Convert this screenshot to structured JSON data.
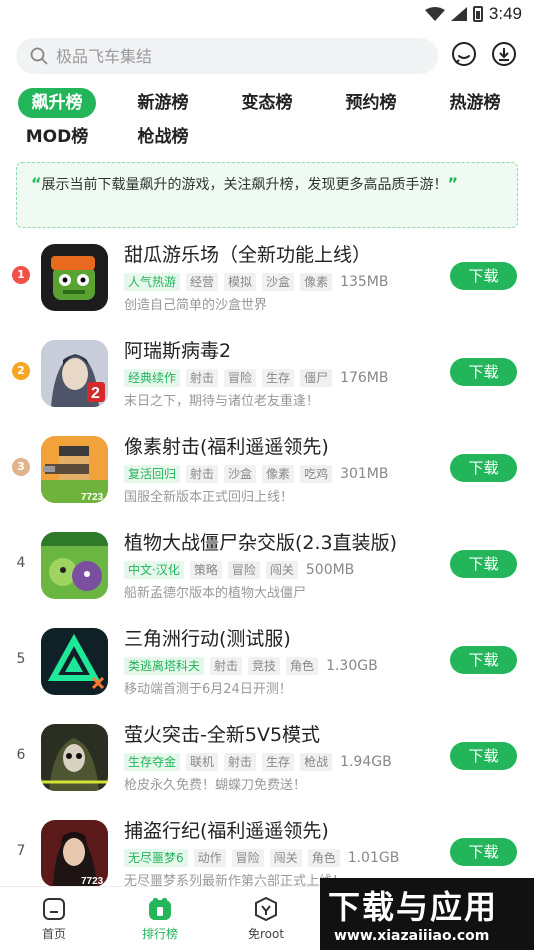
{
  "status": {
    "time": "3:49"
  },
  "search": {
    "placeholder": "极品飞车集结"
  },
  "icons": {
    "search": "search-icon",
    "message": "message-icon",
    "download": "download-icon"
  },
  "tabs": [
    {
      "label": "飙升榜",
      "active": true
    },
    {
      "label": "新游榜"
    },
    {
      "label": "变态榜"
    },
    {
      "label": "预约榜"
    },
    {
      "label": "热游榜"
    },
    {
      "label": "MOD榜"
    },
    {
      "label": "枪战榜"
    }
  ],
  "banner": {
    "open_quote": "“",
    "text": "展示当前下载量飙升的游戏，关注飙升榜，发现更多高品质手游！",
    "close_quote": "”"
  },
  "apps": [
    {
      "rank": "1",
      "title": "甜瓜游乐场（全新功能上线）",
      "tags": [
        "人气热游",
        "经营",
        "模拟",
        "沙盒",
        "像素"
      ],
      "size": "135MB",
      "desc": "创造自己简单的沙盒世界",
      "button": "下载"
    },
    {
      "rank": "2",
      "title": "阿瑞斯病毒2",
      "tags": [
        "经典续作",
        "射击",
        "冒险",
        "生存",
        "僵尸"
      ],
      "size": "176MB",
      "desc": "末日之下，期待与诸位老友重逢！",
      "button": "下载"
    },
    {
      "rank": "3",
      "title": "像素射击(福利遥遥领先)",
      "tags": [
        "复活回归",
        "射击",
        "沙盒",
        "像素",
        "吃鸡"
      ],
      "size": "301MB",
      "desc": "国服全新版本正式回归上线！",
      "button": "下载"
    },
    {
      "rank": "4",
      "title": "植物大战僵尸杂交版(2.3直装版)",
      "tags": [
        "中文·汉化",
        "策略",
        "冒险",
        "闯关"
      ],
      "size": "500MB",
      "desc": "船新孟德尔版本的植物大战僵尸",
      "button": "下载"
    },
    {
      "rank": "5",
      "title": "三角洲行动(测试服)",
      "tags": [
        "类逃离塔科夫",
        "射击",
        "竞技",
        "角色"
      ],
      "size": "1.30GB",
      "desc": "移动端首测于6月24日开测！",
      "button": "下载"
    },
    {
      "rank": "6",
      "title": "萤火突击-全新5V5模式",
      "tags": [
        "生存夺金",
        "联机",
        "射击",
        "生存",
        "枪战"
      ],
      "size": "1.94GB",
      "desc": "枪皮永久免费！蝴蝶刀免费送！",
      "button": "下载"
    },
    {
      "rank": "7",
      "title": "捕盗行纪(福利遥遥领先)",
      "tags": [
        "无尽噩梦6",
        "动作",
        "冒险",
        "闯关",
        "角色"
      ],
      "size": "1.01GB",
      "desc": "无尽噩梦系列最新作第六部正式上线！",
      "button": "下载"
    }
  ],
  "rank_colors": {
    "1": "#f0524a",
    "2": "#f5a623",
    "3": "#e0b48c"
  },
  "bottom_nav": [
    {
      "label": "首页",
      "icon": "home-icon"
    },
    {
      "label": "排行榜",
      "icon": "ranking-icon",
      "active": true
    },
    {
      "label": "免root",
      "icon": "shield-icon"
    }
  ],
  "watermark": {
    "top": "下载与应用",
    "bottom": "www.xiazaiiiao.com"
  },
  "colors": {
    "accent": "#22b55a"
  }
}
